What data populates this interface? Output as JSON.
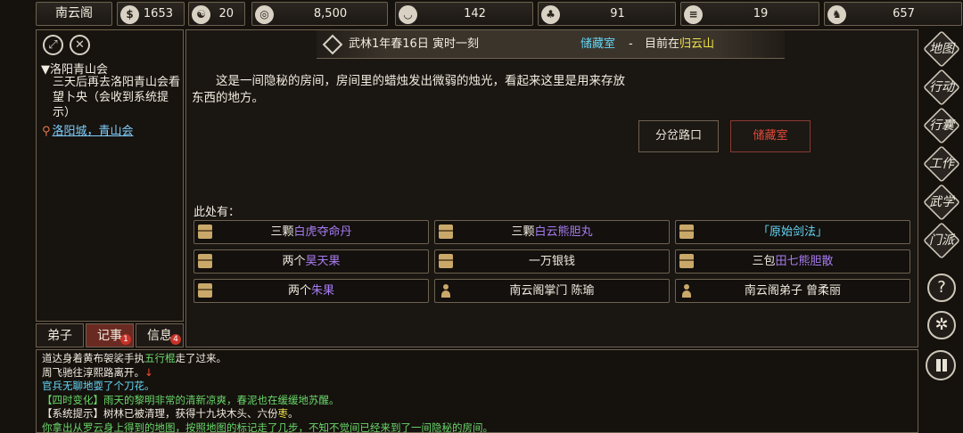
{
  "topbar": {
    "sect_name": "南云阁",
    "stats": [
      {
        "icon": "coin-pouch-icon",
        "value": "1653"
      },
      {
        "icon": "yin-yang-icon",
        "value": "20"
      },
      {
        "icon": "copper-coin-icon",
        "value": "8,500"
      },
      {
        "icon": "food-bowl-icon",
        "value": "142"
      },
      {
        "icon": "herb-icon",
        "value": "91"
      },
      {
        "icon": "scroll-icon",
        "value": "19"
      },
      {
        "icon": "beast-icon",
        "value": "657"
      }
    ]
  },
  "quest": {
    "title": "▼洛阳青山会",
    "description": "三天后再去洛阳青山会看望卜央（会收到系统提示）",
    "location": "洛阳城，青山会"
  },
  "tabs": [
    {
      "label": "弟子",
      "badge": ""
    },
    {
      "label": "记事",
      "badge": "1"
    },
    {
      "label": "信息",
      "badge": "4"
    }
  ],
  "header": {
    "date": "武林1年春16日 寅时一刻",
    "room": "储藏室",
    "separator": "-",
    "location_prefix": "目前在",
    "location": "归云山"
  },
  "room_description": "这是一间隐秘的房间，房间里的蜡烛发出微弱的烛光，看起来这里是用来存放东西的地方。",
  "exits": [
    "分岔路口",
    "储藏室"
  ],
  "here_label": "此处有：",
  "items": [
    {
      "prefix": "三颗",
      "name": "白虎夺命丹",
      "suffix": "",
      "color": "#a77bf0",
      "icon": "chest-icon"
    },
    {
      "prefix": "三颗",
      "name": "白云熊胆丸",
      "suffix": "",
      "color": "#a77bf0",
      "icon": "chest-icon"
    },
    {
      "prefix": "",
      "name": "「原始剑法」",
      "suffix": "",
      "color": "#63d6f5",
      "icon": "chest-icon"
    },
    {
      "prefix": "两个",
      "name": "昊天果",
      "suffix": "",
      "color": "#a77bf0",
      "icon": "chest-icon"
    },
    {
      "prefix": "一万银钱",
      "name": "",
      "suffix": "",
      "color": "#f2ece0",
      "icon": "chest-icon"
    },
    {
      "prefix": "三包",
      "name": "田七熊胆散",
      "suffix": "",
      "color": "#a77bf0",
      "icon": "chest-icon"
    },
    {
      "prefix": "两个",
      "name": "朱果",
      "suffix": "",
      "color": "#a77bf0",
      "icon": "chest-icon"
    },
    {
      "prefix": "南云阁掌门 陈瑜",
      "name": "",
      "suffix": "",
      "color": "#f2ece0",
      "icon": "person-icon"
    },
    {
      "prefix": "南云阁弟子 曾柔丽",
      "name": "",
      "suffix": "",
      "color": "#f2ece0",
      "icon": "person-icon"
    }
  ],
  "right_menu": [
    "地图",
    "行动",
    "行囊",
    "工作",
    "武学",
    "门派"
  ],
  "log": [
    {
      "parts": [
        {
          "t": "道达身着黄布袈裟手执",
          "c": "white"
        },
        {
          "t": "五行棍",
          "c": "green"
        },
        {
          "t": "走了过来。",
          "c": "white"
        }
      ]
    },
    {
      "parts": [
        {
          "t": "周飞驰往淳熙路离开。",
          "c": "white"
        },
        {
          "t": "↓",
          "c": "red"
        }
      ]
    },
    {
      "parts": [
        {
          "t": "官兵无聊地耍了个刀花。",
          "c": "cyan"
        }
      ]
    },
    {
      "parts": [
        {
          "t": "【四时变化】雨天的黎明非常的清新凉爽，春泥也在缓缓地苏醒。",
          "c": "green"
        }
      ]
    },
    {
      "parts": [
        {
          "t": "【系统提示】树林已被清理，获得十九块木头、六份",
          "c": "white"
        },
        {
          "t": "枣",
          "c": "yellow"
        },
        {
          "t": "。",
          "c": "white"
        }
      ]
    },
    {
      "parts": [
        {
          "t": "你拿出从罗云身上得到的地图，按照地图的标记走了几步，不知不觉间已经来到了一间隐秘的房间。",
          "c": "green"
        }
      ]
    }
  ]
}
